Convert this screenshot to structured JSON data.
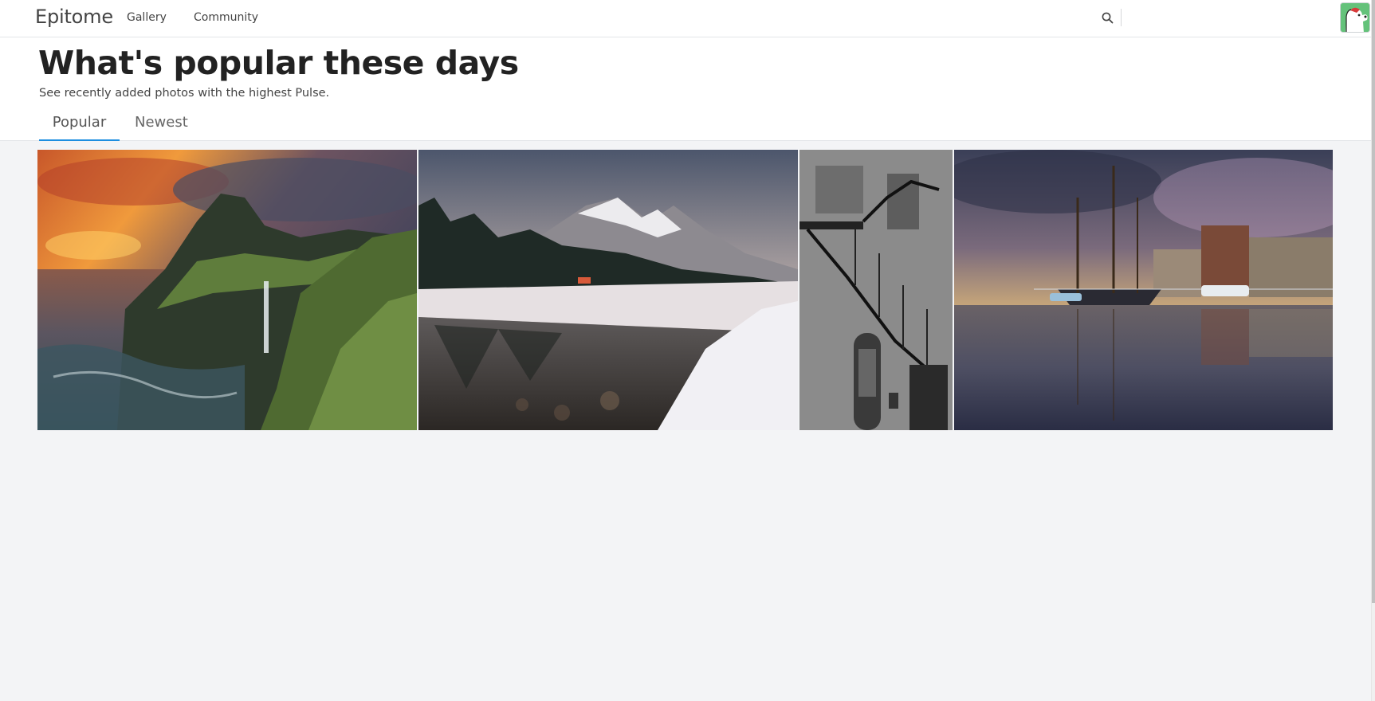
{
  "app": {
    "brand": "Epitome"
  },
  "nav": {
    "items": [
      {
        "label": "Gallery"
      },
      {
        "label": "Community"
      }
    ]
  },
  "header": {
    "title": "What's popular these days",
    "subtitle": "See recently added photos with the highest Pulse.",
    "tabs": [
      {
        "label": "Popular",
        "active": true
      },
      {
        "label": "Newest",
        "active": false
      }
    ]
  },
  "icons": {
    "search": "search-icon",
    "avatar": "avatar-image"
  },
  "colors": {
    "accent": "#1d8ee0",
    "page_background": "#f3f4f6",
    "header_background": "#ffffff"
  },
  "gallery": {
    "photos": [
      {
        "subject": "cliff-waterfall-sunset"
      },
      {
        "subject": "snowy-mountain-lake"
      },
      {
        "subject": "black-white-staircase"
      },
      {
        "subject": "harbor-tall-ship"
      }
    ]
  }
}
